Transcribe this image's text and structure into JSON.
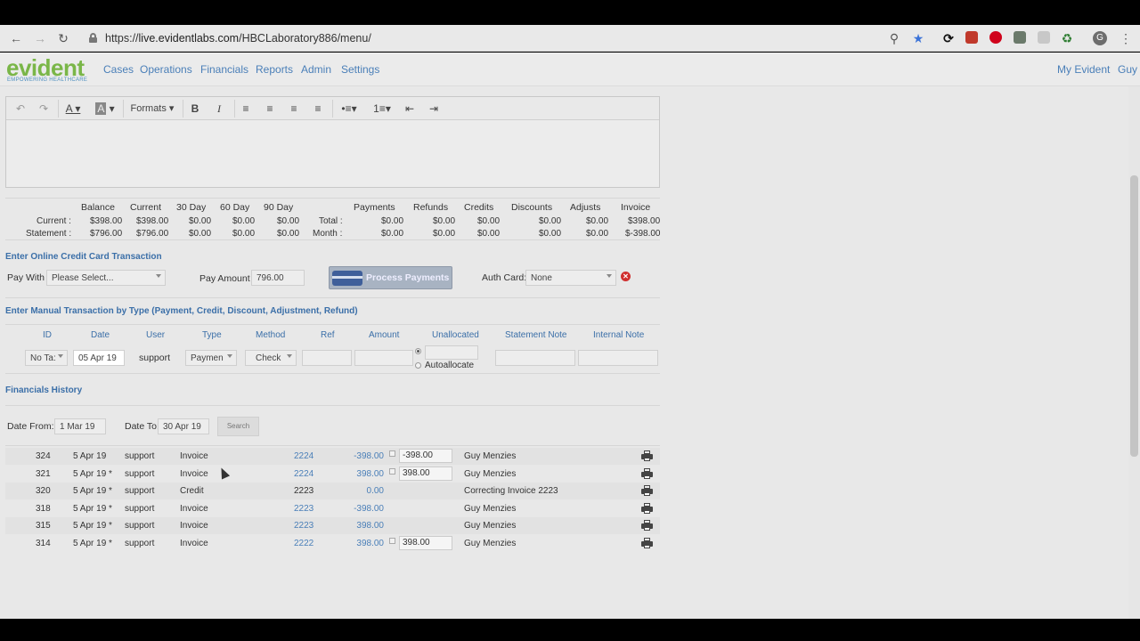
{
  "browser": {
    "url_prefix": "https://",
    "url_host": "live.evidentlabs.com",
    "url_path": "/HBCLaboratory886/menu/",
    "profile_initial": "G"
  },
  "app": {
    "logo": "evident",
    "logo_tagline": "EMPOWERING HEALTHCARE",
    "nav": [
      "Cases",
      "Operations",
      "Financials",
      "Reports",
      "Admin",
      "Settings"
    ],
    "nav_right": [
      "My Evident",
      "Guy"
    ]
  },
  "editor": {
    "formats_label": "Formats"
  },
  "summary": {
    "headers": [
      "Balance",
      "Current",
      "30 Day",
      "60 Day",
      "90 Day",
      "Payments",
      "Refunds",
      "Credits",
      "Discounts",
      "Adjusts",
      "Invoice"
    ],
    "rows": [
      {
        "label": "Current :",
        "values": [
          "$398.00",
          "$398.00",
          "$0.00",
          "$0.00",
          "$0.00"
        ],
        "mid_label": "Total :",
        "values2": [
          "$0.00",
          "$0.00",
          "$0.00",
          "$0.00",
          "$0.00",
          "$398.00"
        ]
      },
      {
        "label": "Statement :",
        "values": [
          "$796.00",
          "$796.00",
          "$0.00",
          "$0.00",
          "$0.00"
        ],
        "mid_label": "Month :",
        "values2": [
          "$0.00",
          "$0.00",
          "$0.00",
          "$0.00",
          "$0.00",
          "$-398.00"
        ]
      }
    ]
  },
  "online": {
    "title": "Enter Online Credit Card Transaction",
    "pay_with_label": "Pay With :",
    "pay_with_value": "Please Select...",
    "pay_amount_label": "Pay Amount :",
    "pay_amount_value": "796.00",
    "process_label": "Process Payments",
    "auth_card_label": "Auth Card:",
    "auth_card_value": "None"
  },
  "manual": {
    "title": "Enter Manual Transaction by Type (Payment, Credit, Discount, Adjustment, Refund)",
    "columns": [
      "ID",
      "Date",
      "User",
      "Type",
      "Method",
      "Ref",
      "Amount",
      "Unallocated",
      "Statement Note",
      "Internal Note"
    ],
    "id_value": "No Ta:",
    "date_value": "05 Apr 19",
    "user_value": "support",
    "type_value": "Paymen",
    "method_value": "Check",
    "autoallocate_label": "Autoallocate"
  },
  "history": {
    "title": "Financials History",
    "date_from_label": "Date From:",
    "date_from_value": "1 Mar 19",
    "date_to_label": "Date To:",
    "date_to_value": "30 Apr 19",
    "search_label": "Search",
    "rows": [
      {
        "id": "324",
        "date": "5 Apr 19",
        "user": "support",
        "type": "Invoice",
        "ref": "2224",
        "amount": "-398.00",
        "alloc": "-398.00",
        "note": "Guy Menzies",
        "bold_ref": false
      },
      {
        "id": "321",
        "date": "5 Apr 19 *",
        "user": "support",
        "type": "Invoice",
        "ref": "2224",
        "amount": "398.00",
        "alloc": "398.00",
        "note": "Guy Menzies",
        "bold_ref": false
      },
      {
        "id": "320",
        "date": "5 Apr 19 *",
        "user": "support",
        "type": "Credit",
        "ref": "2223",
        "amount": "0.00",
        "alloc": "",
        "note": "Correcting Invoice 2223",
        "bold_ref": true
      },
      {
        "id": "318",
        "date": "5 Apr 19 *",
        "user": "support",
        "type": "Invoice",
        "ref": "2223",
        "amount": "-398.00",
        "alloc": "",
        "note": "Guy Menzies",
        "bold_ref": false
      },
      {
        "id": "315",
        "date": "5 Apr 19 *",
        "user": "support",
        "type": "Invoice",
        "ref": "2223",
        "amount": "398.00",
        "alloc": "",
        "note": "Guy Menzies",
        "bold_ref": false
      },
      {
        "id": "314",
        "date": "5 Apr 19 *",
        "user": "support",
        "type": "Invoice",
        "ref": "2222",
        "amount": "398.00",
        "alloc": "398.00",
        "note": "Guy Menzies",
        "bold_ref": false
      }
    ]
  }
}
